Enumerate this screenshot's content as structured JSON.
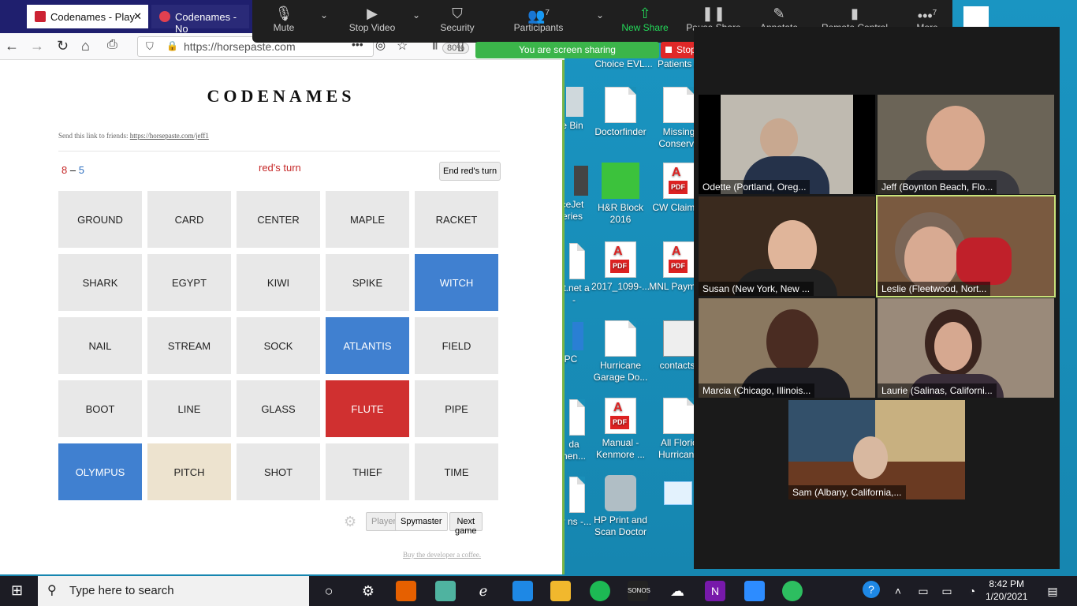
{
  "browser": {
    "tabs": [
      {
        "label": "Codenames - Play"
      },
      {
        "label": "Codenames - No"
      }
    ],
    "url": "https://horsepaste.com",
    "zoom": "80%"
  },
  "game": {
    "title": "CODENAMES",
    "share_prefix": "Send this link to friends:",
    "share_link": "https://horsepaste.com/jeff1",
    "score_red": "8",
    "score_sep": "–",
    "score_blue": "5",
    "turn": "red's turn",
    "end_turn": "End red's turn",
    "cards": [
      {
        "word": "GROUND",
        "state": "hidden"
      },
      {
        "word": "CARD",
        "state": "hidden"
      },
      {
        "word": "CENTER",
        "state": "hidden"
      },
      {
        "word": "MAPLE",
        "state": "hidden"
      },
      {
        "word": "RACKET",
        "state": "hidden"
      },
      {
        "word": "SHARK",
        "state": "hidden"
      },
      {
        "word": "EGYPT",
        "state": "hidden"
      },
      {
        "word": "KIWI",
        "state": "hidden"
      },
      {
        "word": "SPIKE",
        "state": "hidden"
      },
      {
        "word": "WITCH",
        "state": "blue"
      },
      {
        "word": "NAIL",
        "state": "hidden"
      },
      {
        "word": "STREAM",
        "state": "hidden"
      },
      {
        "word": "SOCK",
        "state": "hidden"
      },
      {
        "word": "ATLANTIS",
        "state": "blue"
      },
      {
        "word": "FIELD",
        "state": "hidden"
      },
      {
        "word": "BOOT",
        "state": "hidden"
      },
      {
        "word": "LINE",
        "state": "hidden"
      },
      {
        "word": "GLASS",
        "state": "hidden"
      },
      {
        "word": "FLUTE",
        "state": "red"
      },
      {
        "word": "PIPE",
        "state": "hidden"
      },
      {
        "word": "OLYMPUS",
        "state": "blue"
      },
      {
        "word": "PITCH",
        "state": "neutral"
      },
      {
        "word": "SHOT",
        "state": "hidden"
      },
      {
        "word": "THIEF",
        "state": "hidden"
      },
      {
        "word": "TIME",
        "state": "hidden"
      }
    ],
    "player_label": "Player",
    "spymaster_label": "Spymaster",
    "next_game": "Next game",
    "coffee": "Buy the developer a coffee."
  },
  "zoom": {
    "mute": "Mute",
    "stop_video": "Stop Video",
    "security": "Security",
    "participants": "Participants",
    "participants_count": "7",
    "new_share": "New Share",
    "pause_share": "Pause Share",
    "annotate": "Annotate",
    "remote_control": "Remote Control",
    "more": "More",
    "more_count": "7",
    "sharing": "You are screen sharing",
    "stop_share": "Stop Share"
  },
  "participants": [
    {
      "name": "Odette (Portland, Oreg..."
    },
    {
      "name": "Jeff (Boynton Beach, Flo..."
    },
    {
      "name": "Susan (New York, New ..."
    },
    {
      "name": "Leslie (Fleetwood, Nort..."
    },
    {
      "name": "Marcia (Chicago, Illinois..."
    },
    {
      "name": "Laurie (Salinas, Californi..."
    },
    {
      "name": "Sam (Albany, California,..."
    }
  ],
  "desktop": {
    "icons": [
      "Choice EVL...",
      "Patients A",
      "e Bin",
      "Doctorfinder",
      "Missing Conserva",
      "ceJet eries",
      "H&R Block 2016",
      "CW Claiman",
      "st.net a -",
      "2017_1099-...",
      "MNL Payment",
      "PC",
      "Hurricane Garage Do...",
      "contacts(",
      "da nen...",
      "Manual - Kenmore ...",
      "All Floric Hurricane",
      "or ns -...",
      "HP Print and Scan Doctor"
    ]
  },
  "taskbar": {
    "search_placeholder": "Type here to search",
    "time": "8:42 PM",
    "date": "1/20/2021"
  }
}
